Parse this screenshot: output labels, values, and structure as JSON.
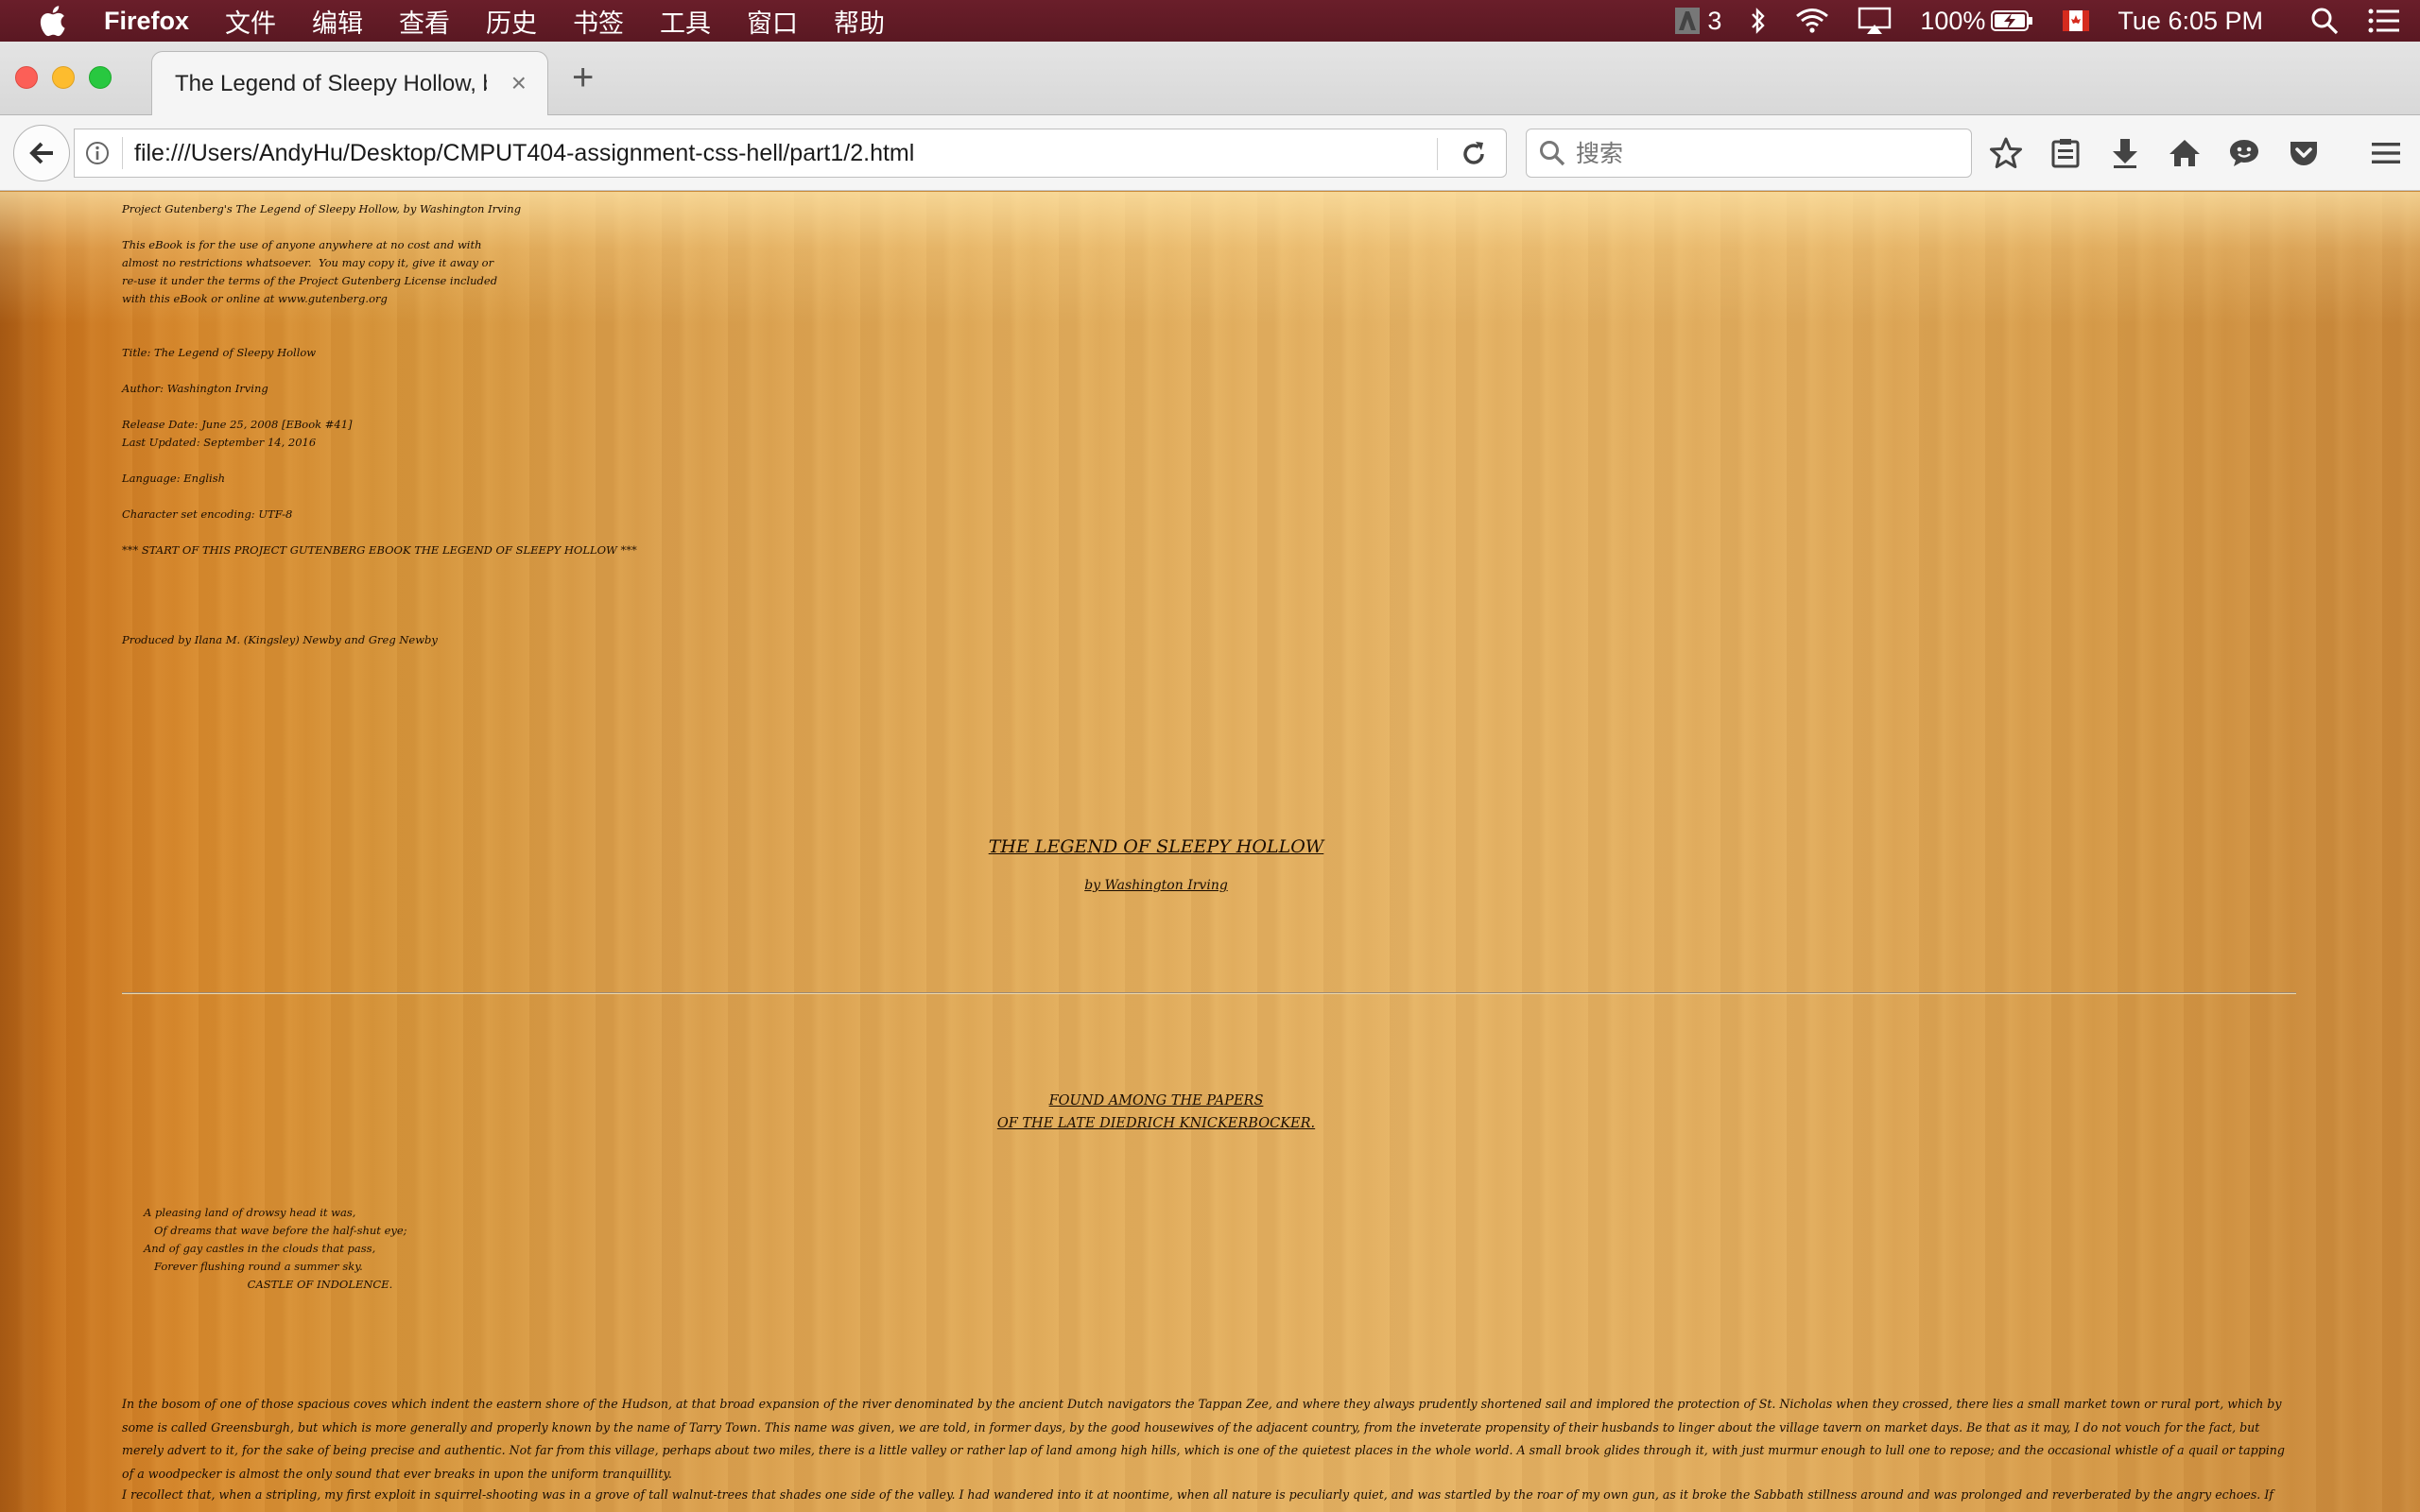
{
  "menubar": {
    "app_name": "Firefox",
    "items": [
      "文件",
      "编辑",
      "查看",
      "历史",
      "书签",
      "工具",
      "窗口",
      "帮助"
    ],
    "status": {
      "adobe_count": "3",
      "battery": "100%",
      "clock": "Tue 6:05 PM"
    }
  },
  "browser": {
    "tab_title": "The Legend of Sleepy Hollow, b...",
    "tab_close": "×",
    "new_tab": "+",
    "url": "file:///Users/AndyHu/Desktop/CMPUT404-assignment-css-hell/part1/2.html",
    "search_placeholder": "搜索"
  },
  "page": {
    "header_line": "Project Gutenberg's The Legend of Sleepy Hollow, by Washington Irving",
    "license": "This eBook is for the use of anyone anywhere at no cost and with\nalmost no restrictions whatsoever.  You may copy it, give it away or\nre-use it under the terms of the Project Gutenberg License included\nwith this eBook or online at www.gutenberg.org",
    "meta_title": "Title: The Legend of Sleepy Hollow",
    "meta_author": "Author: Washington Irving",
    "meta_dates": "Release Date: June 25, 2008 [EBook #41]\nLast Updated: September 14, 2016",
    "meta_language": "Language: English",
    "meta_encoding": "Character set encoding: UTF-8",
    "start_marker": "*** START OF THIS PROJECT GUTENBERG EBOOK THE LEGEND OF SLEEPY HOLLOW ***",
    "produced_by": "Produced by Ilana M. (Kingsley) Newby and Greg Newby",
    "title": "THE LEGEND OF SLEEPY HOLLOW",
    "byline": "by Washington Irving",
    "found_among": "FOUND AMONG THE PAPERS\nOF THE LATE DIEDRICH KNICKERBOCKER.",
    "poem": "A pleasing land of drowsy head it was,\n   Of dreams that wave before the half-shut eye;\nAnd of gay castles in the clouds that pass,\n   Forever flushing round a summer sky.\n                              CASTLE OF INDOLENCE.",
    "paragraph_1": "In the bosom of one of those spacious coves which indent the eastern shore of the Hudson, at that broad expansion of the river denominated by the ancient Dutch navigators the Tappan Zee, and where they always prudently shortened sail and implored the protection of St. Nicholas when they crossed, there lies a small market town or rural port, which by some is called Greensburgh, but which is more generally and properly known by the name of Tarry Town. This name was given, we are told, in former days, by the good housewives of the adjacent country, from the inveterate propensity of their husbands to linger about the village tavern on market days. Be that as it may, I do not vouch for the fact, but merely advert to it, for the sake of being precise and authentic. Not far from this village, perhaps about two miles, there is a little valley or rather lap of land among high hills, which is one of the quietest places in the whole world. A small brook glides through it, with just murmur enough to lull one to repose; and the occasional whistle of a quail or tapping of a woodpecker is almost the only sound that ever breaks in upon the uniform tranquillity.",
    "paragraph_2": "I recollect that, when a stripling, my first exploit in squirrel-shooting was in a grove of tall walnut-trees that shades one side of the valley. I had wandered into it at noontime, when all nature is peculiarly quiet, and was startled by the roar of my own gun, as it broke the Sabbath stillness around and was prolonged and reverberated by the angry echoes. If ever I should wish for a retreat whither I might steal from the world"
  }
}
